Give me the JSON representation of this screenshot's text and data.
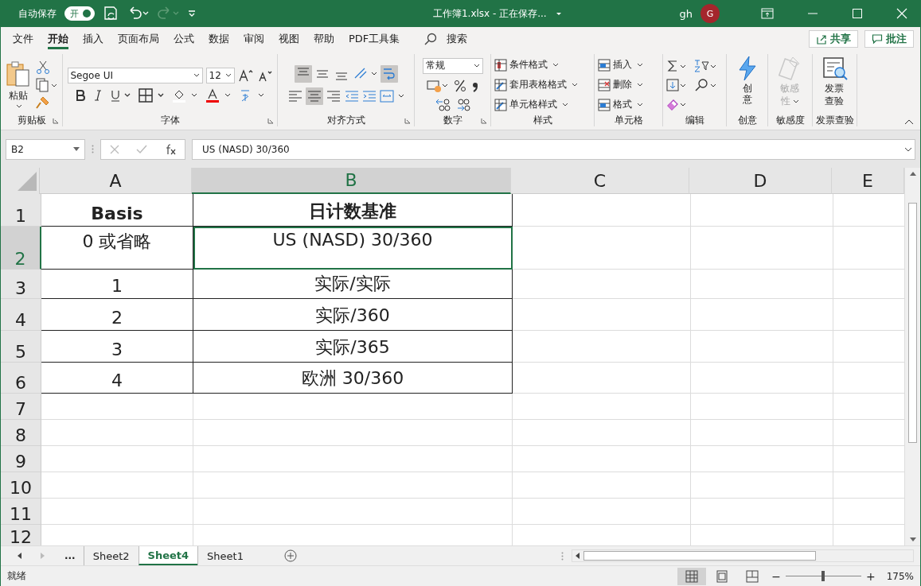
{
  "title_bar": {
    "autosave_label": "自动保存",
    "autosave": {
      "label": "开",
      "on": true
    },
    "file_title": "工作簿1.xlsx  -  正在保存...",
    "user": "gh",
    "avatar": "G"
  },
  "menu_tabs": [
    {
      "label": "文件",
      "selected": false
    },
    {
      "label": "开始",
      "selected": true
    },
    {
      "label": "插入",
      "selected": false
    },
    {
      "label": "页面布局",
      "selected": false
    },
    {
      "label": "公式",
      "selected": false
    },
    {
      "label": "数据",
      "selected": false
    },
    {
      "label": "审阅",
      "selected": false
    },
    {
      "label": "视图",
      "selected": false
    },
    {
      "label": "帮助",
      "selected": false
    },
    {
      "label": "PDF工具集",
      "selected": false
    }
  ],
  "search": {
    "placeholder": "搜索"
  },
  "share_button": "共享",
  "comments_button": "批注",
  "ribbon": {
    "clipboard": {
      "label": "剪贴板",
      "paste": "粘贴"
    },
    "font": {
      "label": "字体",
      "family": "Segoe UI",
      "size": "12"
    },
    "alignment": {
      "label": "对齐方式",
      "vertical_align": [
        {
          "selected": true
        },
        {
          "selected": false
        },
        {
          "selected": false
        }
      ],
      "horizontal_align": [
        {
          "selected": false
        },
        {
          "selected": true
        },
        {
          "selected": false
        }
      ],
      "wrap_text": {
        "on": true
      }
    },
    "number": {
      "label": "数字",
      "format": "常规"
    },
    "styles": {
      "label": "样式",
      "items": [
        "条件格式",
        "套用表格格式",
        "单元格样式"
      ]
    },
    "cells": {
      "label": "单元格",
      "items": [
        "插入",
        "删除",
        "格式"
      ]
    },
    "editing": {
      "label": "编辑"
    },
    "ideas": {
      "label": "创意",
      "button": "创意"
    },
    "sensitivity": {
      "label": "敏感度",
      "button": "敏感性",
      "disabled": true
    },
    "invoice": {
      "label": "发票查验",
      "button": "发票查验"
    }
  },
  "formula_bar": {
    "name_box": "B2",
    "formula": "US (NASD) 30/360"
  },
  "sheet": {
    "columns": [
      {
        "label": "A",
        "selected": false
      },
      {
        "label": "B",
        "selected": true
      },
      {
        "label": "C",
        "selected": false
      },
      {
        "label": "D",
        "selected": false
      },
      {
        "label": "E",
        "selected": false
      }
    ],
    "rows": [
      {
        "number": "1",
        "kind": "header",
        "selected": false,
        "cells": [
          "Basis",
          "日计数基准"
        ]
      },
      {
        "number": "2",
        "kind": "data",
        "selected": true,
        "cells": [
          "0 或省略",
          "US (NASD) 30/360"
        ]
      },
      {
        "number": "3",
        "kind": "data",
        "selected": false,
        "cells": [
          "1",
          "实际/实际"
        ]
      },
      {
        "number": "4",
        "kind": "data",
        "selected": false,
        "cells": [
          "2",
          "实际/360"
        ]
      },
      {
        "number": "5",
        "kind": "data",
        "selected": false,
        "cells": [
          "3",
          "实际/365"
        ]
      },
      {
        "number": "6",
        "kind": "data",
        "selected": false,
        "cells": [
          "4",
          "欧洲 30/360"
        ]
      },
      {
        "number": "7",
        "kind": "empty",
        "selected": false,
        "cells": []
      },
      {
        "number": "8",
        "kind": "empty",
        "selected": false,
        "cells": []
      },
      {
        "number": "9",
        "kind": "empty",
        "selected": false,
        "cells": []
      },
      {
        "number": "10",
        "kind": "empty",
        "selected": false,
        "cells": []
      },
      {
        "number": "11",
        "kind": "empty",
        "selected": false,
        "cells": []
      },
      {
        "number": "12",
        "kind": "empty",
        "selected": false,
        "cells": []
      }
    ]
  },
  "sheet_tabs": [
    {
      "label": "...",
      "kind": "more"
    },
    {
      "label": "Sheet2",
      "kind": "sheet",
      "selected": false
    },
    {
      "label": "Sheet4",
      "kind": "sheet",
      "selected": true
    },
    {
      "label": "Sheet1",
      "kind": "sheet",
      "selected": false
    }
  ],
  "status_bar": {
    "status": "就绪",
    "views": [
      {
        "selected": true
      },
      {
        "selected": false
      },
      {
        "selected": false
      }
    ],
    "zoom": {
      "minus": "−",
      "level": 0.5,
      "plus": "+",
      "reading": "175%"
    }
  }
}
